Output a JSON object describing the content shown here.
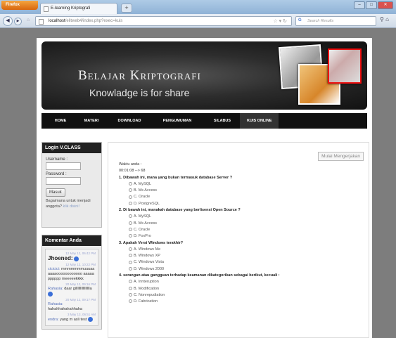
{
  "browser": {
    "app_button": "Firefox",
    "tab_title": "E-learning Kriptografi",
    "url_host": "localhost",
    "url_path": "/elitweb4/index.php?exec=kuis",
    "search_placeholder": "Search Results"
  },
  "banner": {
    "title": "Belajar Kriptografi",
    "subtitle": "Knowladge is for share"
  },
  "menu": [
    {
      "label": "HOME"
    },
    {
      "label": "MATERI"
    },
    {
      "label": "DOWNLOAD"
    },
    {
      "label": "PENGUMUMAN"
    },
    {
      "label": "SILABUS"
    },
    {
      "label": "KUIS ONLINE"
    }
  ],
  "login": {
    "heading": "Login V.CLASS",
    "username_label": "Username :",
    "password_label": "Password :",
    "submit_label": "Masuk",
    "help_text": "Bagaimana untuk menjadi anggota?",
    "help_link": "klik disini!"
  },
  "shoutbox": {
    "heading": "Komentar Anda",
    "entries": [
      {
        "time": "12 May 12, 06:42 PM",
        "name": "Jhoened:",
        "text": ""
      },
      {
        "time": "12 May 12, 10:22 PM",
        "name": "cicicici:",
        "text": "mmmmmmmuuuaaaaaaoooooooooooo aaaaapppppp meeeeekkkk"
      },
      {
        "time": "20 May 12, 09:16 PM",
        "name": "Rahasia:",
        "text": "daar gilllllllllllllllla"
      },
      {
        "time": "20 May 12, 09:17 PM",
        "name": "Rahasia:",
        "text": "hahahhahahahhaha"
      },
      {
        "time": "3 May 13, 06:51 AM",
        "name": "endra:",
        "text": "yang m asli test"
      }
    ]
  },
  "quiz": {
    "start_button": "Mulai Mengerjakan",
    "time_label": "Waktu anda :",
    "time_value": "00:01:08 --> 68",
    "questions": [
      {
        "text": "1. Dibawah ini, mana yang bukan termasuk database Server ?",
        "options": [
          "A. MySQL",
          "B. Ms Access",
          "C. Oracle",
          "D. PostgreSQL"
        ]
      },
      {
        "text": "2. Di bawah ini, manakah database yang berlisensi Open Source ?",
        "options": [
          "A. MySQL",
          "B. Ms Access",
          "C. Oracle",
          "D. FoxPro"
        ]
      },
      {
        "text": "3. Apakah Versi Windows terakhir?",
        "options": [
          "A. Windows Me",
          "B. Windows XP",
          "C. Windows Vista",
          "D. Windows 2000"
        ]
      },
      {
        "text": "4. serangan atau gangguan terhadap keamanan dikategorikan sebagai berikut, kecuali :",
        "options": [
          "A. Innteruption",
          "B. Modification",
          "C. Nonrepudiation",
          "D. Fabrication"
        ]
      }
    ]
  }
}
